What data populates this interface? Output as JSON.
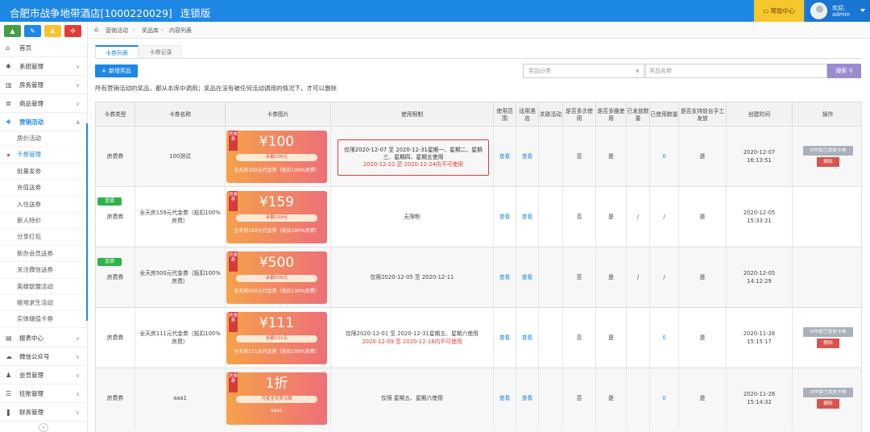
{
  "header": {
    "title": "合肥市战争地带酒店[1000220029]",
    "edition": "连锁版",
    "help_label": "帮助中心",
    "welcome": "欢迎,",
    "username": "admin"
  },
  "sidebar": {
    "quick": [
      {
        "icon": "signal-icon",
        "glyph": "▲",
        "color": "#43a047"
      },
      {
        "icon": "pencil-icon",
        "glyph": "✎",
        "color": "#1e88e5"
      },
      {
        "icon": "users-icon",
        "glyph": "♟",
        "color": "#fbc02d"
      },
      {
        "icon": "share-icon",
        "glyph": "✣",
        "color": "#e53935"
      }
    ],
    "items": [
      {
        "label": "首页",
        "icon": "home-icon",
        "glyph": "⌂",
        "chevron": ""
      },
      {
        "label": "系统管理",
        "icon": "gear-icon",
        "glyph": "✱",
        "chevron": "∨"
      },
      {
        "label": "房务管理",
        "icon": "bank-icon",
        "glyph": "▥",
        "chevron": "∨"
      },
      {
        "label": "商品管理",
        "icon": "database-icon",
        "glyph": "≣",
        "chevron": "∨"
      },
      {
        "label": "营销活动",
        "icon": "gift-icon",
        "glyph": "❖",
        "chevron": "∧"
      }
    ],
    "sub_items": [
      "房价活动",
      "卡券管理",
      "批量发券",
      "充值送券",
      "入住送券",
      "新人特价",
      "分享红包",
      "新办会员送券",
      "关注微信送券",
      "英雄联盟活动",
      "绝地求生活动",
      "实体储值卡券"
    ],
    "bottom_items": [
      {
        "label": "报表中心",
        "icon": "chart-icon",
        "glyph": "▤",
        "chevron": "∨"
      },
      {
        "label": "微信公众号",
        "icon": "cloud-icon",
        "glyph": "☁",
        "chevron": "∨"
      },
      {
        "label": "会员管理",
        "icon": "members-icon",
        "glyph": "♟",
        "chevron": "∨"
      },
      {
        "label": "挂账管理",
        "icon": "list-icon",
        "glyph": "☰",
        "chevron": "∨"
      },
      {
        "label": "财务管理",
        "icon": "finance-icon",
        "glyph": "❚",
        "chevron": "∨"
      }
    ],
    "collapse": "«"
  },
  "breadcrumb": {
    "items": [
      "营销活动",
      "奖品库",
      "内容列表"
    ],
    "sep": "›"
  },
  "tabs": {
    "active": "卡券列表",
    "other": "卡券记录"
  },
  "toolbar": {
    "add_label": "新增奖品",
    "category_placeholder": "奖品分类",
    "name_placeholder": "奖品名称",
    "search_label": "搜索"
  },
  "notice": "所有营销活动的奖品，都从本库中调用；奖品在没有被任何活动调用的情况下，才可以删除",
  "table": {
    "headers": [
      "卡券类型",
      "卡券名称",
      "卡券图片",
      "使用限制",
      "使用范围",
      "适用酒店",
      "关联活动",
      "是否多次使用",
      "是否多晚使用",
      "已发放数量",
      "已使用数量",
      "是否支持前台手工发放",
      "创建时间",
      "操作"
    ],
    "view_label": "查看",
    "rows": [
      {
        "badge": "",
        "type": "房费券",
        "name": "100测试",
        "ribbon": "房费券",
        "amount": "¥100",
        "pill": "余额100元",
        "desc": "全天房100元代金券（抵扣100%房费）",
        "limit": [
          "仅限2020-12-07 至 2020-12-31星期一、星期二、星期",
          "三、星期四、星期五使用"
        ],
        "limit_red": "2020-12-22 至 2020-12-24内不可使用",
        "multi": "否",
        "multi_night": "是",
        "issued": "",
        "used": "0",
        "manual": "是",
        "created": [
          "2020-12-07",
          "16:13:51"
        ],
        "op1": "作废已发放卡券",
        "op2": "删除"
      },
      {
        "badge": "连锁",
        "type": "房费券",
        "name": "全天房159元代金券（抵扣100%房费）",
        "ribbon": "房费券",
        "amount": "¥159",
        "pill": "余额159元",
        "desc": "全天房159元代金券（抵扣100%房费）",
        "limit": [
          "无限制"
        ],
        "limit_red": "",
        "multi": "否",
        "multi_night": "是",
        "issued": "/",
        "used": "/",
        "manual": "是",
        "created": [
          "2020-12-05",
          "15:33:21"
        ],
        "op1": "",
        "op2": ""
      },
      {
        "badge": "连锁",
        "type": "房费券",
        "name": "全天房500元代金券（抵扣100%房费）",
        "ribbon": "房费券",
        "amount": "¥500",
        "pill": "余额500元",
        "desc": "全天房500元代金券（抵扣100%房费）",
        "limit": [
          "仅限2020-12-05 至 2020-12-11"
        ],
        "limit_red": "",
        "multi": "否",
        "multi_night": "是",
        "issued": "/",
        "used": "/",
        "manual": "是",
        "created": [
          "2020-12-05",
          "14:12:29"
        ],
        "op1": "",
        "op2": ""
      },
      {
        "badge": "",
        "type": "房费券",
        "name": "全天房111元代金券（抵扣100%房费）",
        "ribbon": "房费券",
        "amount": "¥111",
        "pill": "余额111元",
        "desc": "全天房111元代金券（抵扣100%房费）",
        "limit": [
          "仅限2020-12-01 至 2020-12-31星期五、星期六使用"
        ],
        "limit_red": "2020-12-09 至 2020-12-18内不可使用",
        "multi": "否",
        "multi_night": "是",
        "issued": "",
        "used": "0",
        "manual": "是",
        "created": [
          "2020-11-26",
          "15:15:17"
        ],
        "op1": "作废已发放卡券",
        "op2": "删除"
      },
      {
        "badge": "",
        "type": "房费券",
        "name": "aaa1",
        "ribbon": "房费券",
        "amount": "1折",
        "pill": "可抵全天房/1晚",
        "desc": "aaa1",
        "limit": [
          "仅限 星期五、星期六使用"
        ],
        "limit_red": "",
        "multi": "否",
        "multi_night": "是",
        "issued": "",
        "used": "0",
        "manual": "是",
        "created": [
          "2020-11-26",
          "15:14:32"
        ],
        "op1": "作废已发放卡券",
        "op2": "删除"
      }
    ]
  },
  "colors": {
    "primary": "#1e88e5",
    "help_bg": "#f6c62d",
    "search_btn": "#9c8bcf",
    "danger": "#d9534f",
    "badge": "#2db34a"
  }
}
